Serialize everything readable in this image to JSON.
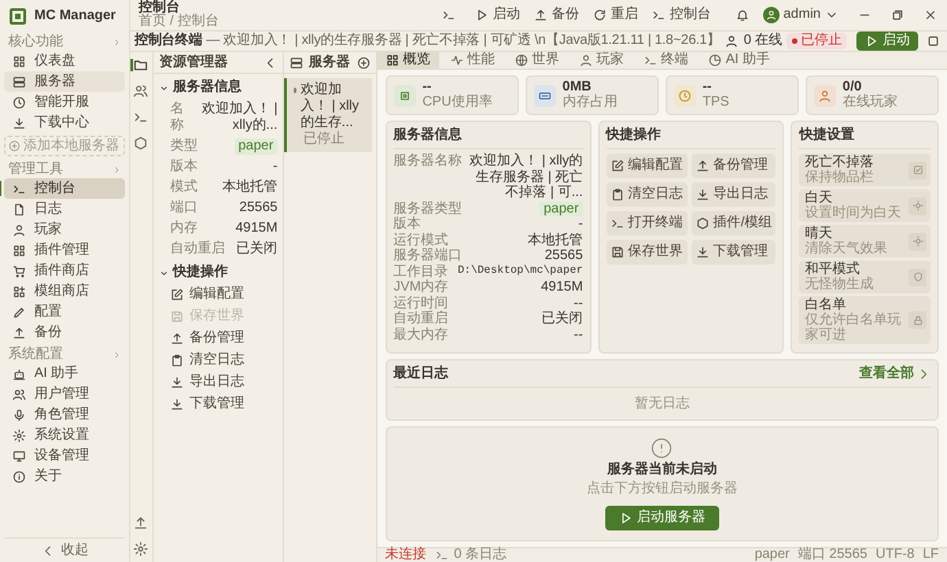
{
  "sidebar": {
    "logo": "MC Manager",
    "sections": [
      {
        "title": "核心功能",
        "items": [
          {
            "label": "仪表盘",
            "selected": false,
            "highlighted": false
          },
          {
            "label": "服务器",
            "selected": false,
            "highlighted": true
          },
          {
            "label": "智能开服",
            "selected": false,
            "highlighted": false
          },
          {
            "label": "下载中心",
            "selected": false,
            "highlighted": false
          }
        ],
        "add_button": "添加本地服务器"
      },
      {
        "title": "管理工具",
        "items": [
          {
            "label": "控制台",
            "selected": true,
            "highlighted": false
          },
          {
            "label": "日志",
            "selected": false,
            "highlighted": false
          },
          {
            "label": "玩家",
            "selected": false,
            "highlighted": false
          },
          {
            "label": "插件管理",
            "selected": false,
            "highlighted": false
          },
          {
            "label": "插件商店",
            "selected": false,
            "highlighted": false
          },
          {
            "label": "模组商店",
            "selected": false,
            "highlighted": false
          },
          {
            "label": "配置",
            "selected": false,
            "highlighted": false
          },
          {
            "label": "备份",
            "selected": false,
            "highlighted": false
          }
        ]
      },
      {
        "title": "系统配置",
        "items": [
          {
            "label": "AI 助手",
            "selected": false,
            "highlighted": false
          },
          {
            "label": "用户管理",
            "selected": false,
            "highlighted": false
          },
          {
            "label": "角色管理",
            "selected": false,
            "highlighted": false
          },
          {
            "label": "系统设置",
            "selected": false,
            "highlighted": false
          },
          {
            "label": "设备管理",
            "selected": false,
            "highlighted": false
          },
          {
            "label": "关于",
            "selected": false,
            "highlighted": false
          }
        ]
      }
    ],
    "collapse": "收起"
  },
  "header": {
    "title": "控制台",
    "breadcrumb": "首页 / 控制台",
    "actions": [
      "启动",
      "备份",
      "重启",
      "控制台"
    ],
    "user": "admin"
  },
  "status_strip": {
    "title": "控制台终端",
    "motd": "— 欢迎加入！ | xlly的生存服务器 | 死亡不掉落 | 可矿透 \\n【Java版1.21.11 | 1.8~26.1】",
    "online": "0 在线",
    "status": "已停止",
    "start_button": "启动"
  },
  "explorer": {
    "title": "资源管理器",
    "sections": [
      {
        "title": "服务器信息",
        "expanded": true,
        "rows": [
          {
            "kind": "text",
            "label": "名称",
            "value": "欢迎加入！ | xlly的..."
          },
          {
            "kind": "badge",
            "label": "类型",
            "value": "paper"
          },
          {
            "kind": "text",
            "label": "版本",
            "value": "-"
          },
          {
            "kind": "text",
            "label": "模式",
            "value": "本地托管"
          },
          {
            "kind": "text",
            "label": "端口",
            "value": "25565"
          },
          {
            "kind": "text",
            "label": "内存",
            "value": "4915M"
          },
          {
            "kind": "text",
            "label": "自动重启",
            "value": "已关闭"
          }
        ]
      },
      {
        "title": "快捷操作",
        "expanded": true,
        "actions": [
          {
            "label": "编辑配置",
            "disabled": false
          },
          {
            "label": "保存世界",
            "disabled": true
          },
          {
            "label": "备份管理",
            "disabled": false
          },
          {
            "label": "清空日志",
            "disabled": false
          },
          {
            "label": "导出日志",
            "disabled": false
          },
          {
            "label": "下载管理",
            "disabled": false
          }
        ]
      }
    ]
  },
  "server_list": {
    "title": "服务器",
    "items": [
      {
        "name": "欢迎加入！ | xlly的生存...",
        "status": "已停止",
        "selected": true
      }
    ]
  },
  "tabs": [
    {
      "label": "概览",
      "selected": true
    },
    {
      "label": "性能",
      "selected": false
    },
    {
      "label": "世界",
      "selected": false
    },
    {
      "label": "玩家",
      "selected": false
    },
    {
      "label": "终端",
      "selected": false
    },
    {
      "label": "AI 助手",
      "selected": false
    }
  ],
  "stats": [
    {
      "value": "--",
      "label": "CPU使用率"
    },
    {
      "value": "0MB",
      "label": "内存占用"
    },
    {
      "value": "--",
      "label": "TPS"
    },
    {
      "value": "0/0",
      "label": "在线玩家"
    }
  ],
  "server_info": {
    "title": "服务器信息",
    "rows": [
      {
        "kind": "text",
        "label": "服务器名称",
        "value": "欢迎加入！ | xlly的生存服务器 | 死亡不掉落 | 可..."
      },
      {
        "kind": "badge",
        "label": "服务器类型",
        "value": "paper"
      },
      {
        "kind": "text",
        "label": "版本",
        "value": "-"
      },
      {
        "kind": "text",
        "label": "运行模式",
        "value": "本地托管"
      },
      {
        "kind": "text",
        "label": "服务器端口",
        "value": "25565"
      },
      {
        "kind": "mono",
        "label": "工作目录",
        "value": "D:\\Desktop\\mc\\paper"
      },
      {
        "kind": "text",
        "label": "JVM内存",
        "value": "4915M"
      },
      {
        "kind": "text",
        "label": "运行时间",
        "value": "--"
      },
      {
        "kind": "text",
        "label": "自动重启",
        "value": "已关闭"
      },
      {
        "kind": "text",
        "label": "最大内存",
        "value": "--"
      }
    ]
  },
  "quick_actions": {
    "title": "快捷操作",
    "items": [
      "编辑配置",
      "备份管理",
      "清空日志",
      "导出日志",
      "打开终端",
      "插件/模组",
      "保存世界",
      "下载管理"
    ]
  },
  "quick_settings": {
    "title": "快捷设置",
    "items": [
      {
        "title": "死亡不掉落",
        "desc": "保持物品栏"
      },
      {
        "title": "白天",
        "desc": "设置时间为白天"
      },
      {
        "title": "晴天",
        "desc": "清除天气效果"
      },
      {
        "title": "和平模式",
        "desc": "无怪物生成"
      },
      {
        "title": "白名单",
        "desc": "仅允许白名单玩家可进"
      }
    ]
  },
  "recent_logs": {
    "title": "最近日志",
    "link": "查看全部",
    "empty": "暂无日志"
  },
  "not_started": {
    "title": "服务器当前未启动",
    "hint": "点击下方按钮启动服务器",
    "button": "启动服务器"
  },
  "status_bar": {
    "connection": "未连接",
    "logs": "0 条日志",
    "right": [
      "paper",
      "端口 25565",
      "UTF-8",
      "LF"
    ]
  }
}
